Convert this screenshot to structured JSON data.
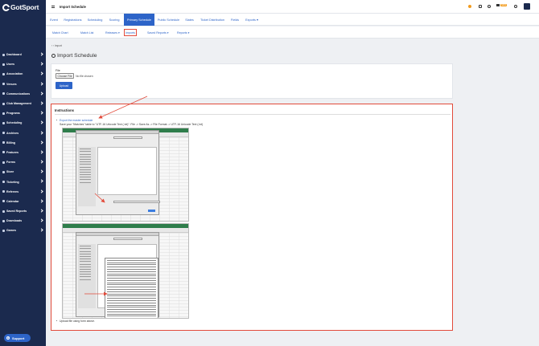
{
  "app": {
    "logo": "GotSport",
    "page_title": "Import Schedule"
  },
  "sidebar": {
    "items": [
      {
        "label": "Dashboard"
      },
      {
        "label": "Users"
      },
      {
        "label": "Association"
      },
      {
        "label": "Venues"
      },
      {
        "label": "Communications"
      },
      {
        "label": "Club Management"
      },
      {
        "label": "Programs"
      },
      {
        "label": "Scheduling"
      },
      {
        "label": "Archives"
      },
      {
        "label": "Billing"
      },
      {
        "label": "Features"
      },
      {
        "label": "Forms"
      },
      {
        "label": "Store"
      },
      {
        "label": "Ticketing"
      },
      {
        "label": "Referees"
      },
      {
        "label": "Calendar"
      },
      {
        "label": "Saved Reports"
      },
      {
        "label": "Downloads"
      },
      {
        "label": "Games"
      }
    ],
    "support_label": "Support"
  },
  "topbar": {
    "badge": "NEW"
  },
  "tabs": [
    {
      "label": "Event"
    },
    {
      "label": "Registrations"
    },
    {
      "label": "Scheduling"
    },
    {
      "label": "Scoring"
    },
    {
      "label": "Primary Schedule"
    },
    {
      "label": "Public Schedule"
    },
    {
      "label": "Slates"
    },
    {
      "label": "Ticket Distribution"
    },
    {
      "label": "Fields"
    },
    {
      "label": "Exports ▾"
    }
  ],
  "subtabs": [
    {
      "label": "Match Chart"
    },
    {
      "label": "Match List"
    },
    {
      "label": "Releases ▾"
    },
    {
      "label": "Imports"
    },
    {
      "label": "Saved Reports ▾"
    },
    {
      "label": "Reports ▾"
    }
  ],
  "breadcrumb": "‹ ‹  Import",
  "heading": "Import Schedule",
  "file_form": {
    "label": "File",
    "choose_label": "Choose File",
    "no_file_text": "No file chosen",
    "upload_label": "Upload"
  },
  "instructions": {
    "title": "Instructions",
    "step1_link": "Export the master schedule",
    "step2": "Save your \"Matches\" table to \"UTF-16 Unicode Text (.txt)\". File -> Save As -> File Format -> UTF-16 Unicode Text (.txt)",
    "step3": "Upload file using form above."
  },
  "colors": {
    "sidebar": "#1b2a4e",
    "accent": "#2d64c8",
    "highlight": "#e24b3b",
    "badge": "#f29b1d"
  }
}
